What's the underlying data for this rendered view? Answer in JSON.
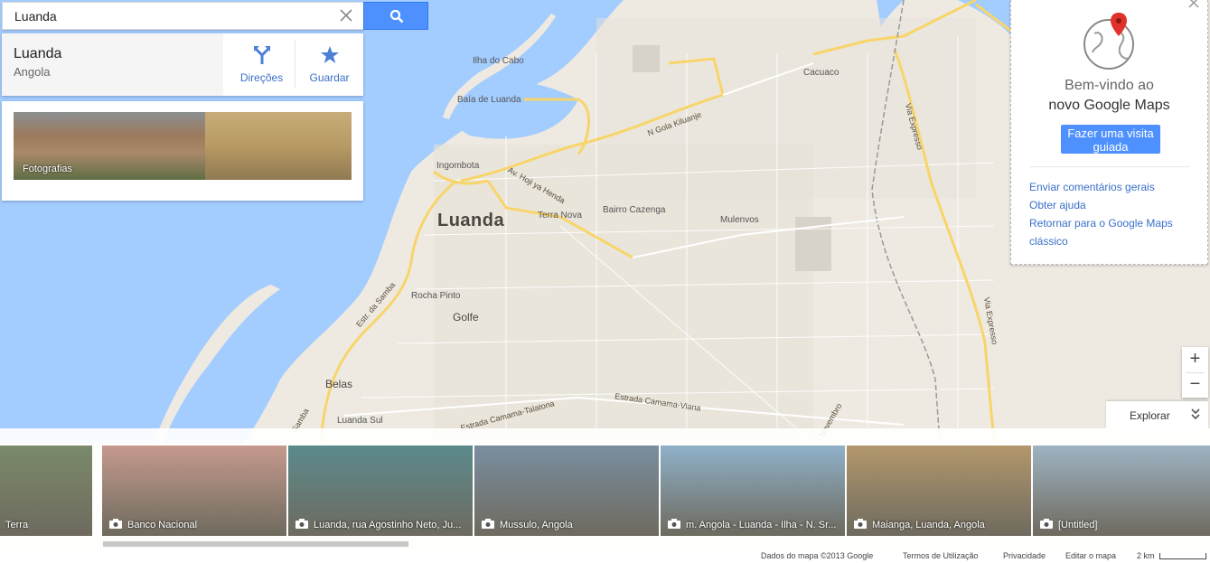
{
  "search": {
    "value": "Luanda"
  },
  "place": {
    "name": "Luanda",
    "country": "Angola",
    "directions_label": "Direções",
    "save_label": "Guardar",
    "photos_label": "Fotografias"
  },
  "map_labels": {
    "city": "Luanda",
    "ilha": "Ilha do Cabo",
    "baia": "Baía de Luanda",
    "ingombota": "Ingombota",
    "terra_nova": "Terra Nova",
    "bairro": "Bairro Cazenga",
    "mulenvos": "Mulenvos",
    "cacuaco": "Cacuaco",
    "rocha": "Rocha Pinto",
    "golfe": "Golfe",
    "belas": "Belas",
    "luanda_sul": "Luanda Sul",
    "road_gola": "N Gola Kiluanje",
    "road_hoji": "Av. Hoji ya Henda",
    "road_samba": "Estr. da Samba",
    "road_samba2": "Samba",
    "road_camama_talatona": "Estrada Camama-Talatona",
    "road_camama_viana": "Estrada Camama-Viana",
    "road_via_expresso1": "Via Expresso",
    "road_via_expresso2": "Via Expresso",
    "road_novembro": "Novembro"
  },
  "welcome": {
    "title_line1": "Bem-vindo ao",
    "title_line2": "novo Google Maps",
    "tour_button": "Fazer uma visita guiada",
    "links": [
      "Enviar comentários gerais",
      "Obter ajuda",
      "Retornar para o Google Maps",
      "clássico"
    ]
  },
  "zoom": {
    "in": "+",
    "out": "−"
  },
  "explore": {
    "label": "Explorar"
  },
  "thumbnails": [
    {
      "caption": "Terra",
      "camera": false,
      "color": "#7a8a6a"
    },
    {
      "caption": "Banco Nacional",
      "camera": true,
      "color": "#c69a8e"
    },
    {
      "caption": "Luanda, rua Agostinho Neto, Ju...",
      "camera": true,
      "color": "#5b8a8c"
    },
    {
      "caption": "Mussulo, Angola",
      "camera": true,
      "color": "#7a8ea0"
    },
    {
      "caption": "m. Angola - Luanda - Ilha - N. Sr...",
      "camera": true,
      "color": "#8fb1c9"
    },
    {
      "caption": "Maianga, Luanda, Angola",
      "camera": true,
      "color": "#b3986c"
    },
    {
      "caption": "[Untitled]",
      "camera": true,
      "color": "#9fb3c4"
    }
  ],
  "footer": {
    "data": "Dados do mapa ©2013 Google",
    "terms": "Termos de Utilização",
    "privacy": "Privacidade",
    "edit": "Editar o mapa",
    "scale": "2 km"
  },
  "colors": {
    "water": "#a3ccff",
    "land": "#eeeae2",
    "road_major": "#f8d56a",
    "accent": "#4d90fe",
    "link": "#3a70c8"
  }
}
